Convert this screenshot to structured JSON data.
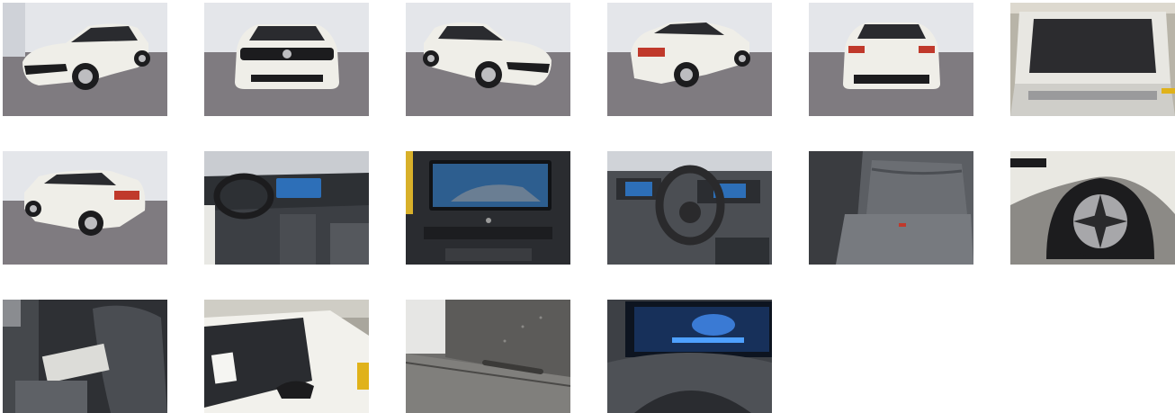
{
  "gallery": {
    "thumbnails": [
      {
        "icon": "car-front-left-photo"
      },
      {
        "icon": "car-front-photo"
      },
      {
        "icon": "car-front-right-photo"
      },
      {
        "icon": "car-rear-right-photo"
      },
      {
        "icon": "car-rear-photo"
      },
      {
        "icon": "trunk-photo"
      },
      {
        "icon": "car-rear-left-photo"
      },
      {
        "icon": "dashboard-photo"
      },
      {
        "icon": "infotainment-screen-photo"
      },
      {
        "icon": "steering-wheel-photo"
      },
      {
        "icon": "rear-seats-photo"
      },
      {
        "icon": "wheel-photo"
      },
      {
        "icon": "front-seat-photo"
      },
      {
        "icon": "window-sticker-photo"
      },
      {
        "icon": "scratched-panel-photo"
      },
      {
        "icon": "instrument-cluster-photo"
      }
    ]
  },
  "colors": {
    "studio_wall": "#e4e6ea",
    "studio_floor": "#7f7b80",
    "car_body": "#efeee8",
    "car_black": "#1c1c1e",
    "interior": "#4a4d52",
    "screen_blue": "#2d6fb8"
  }
}
